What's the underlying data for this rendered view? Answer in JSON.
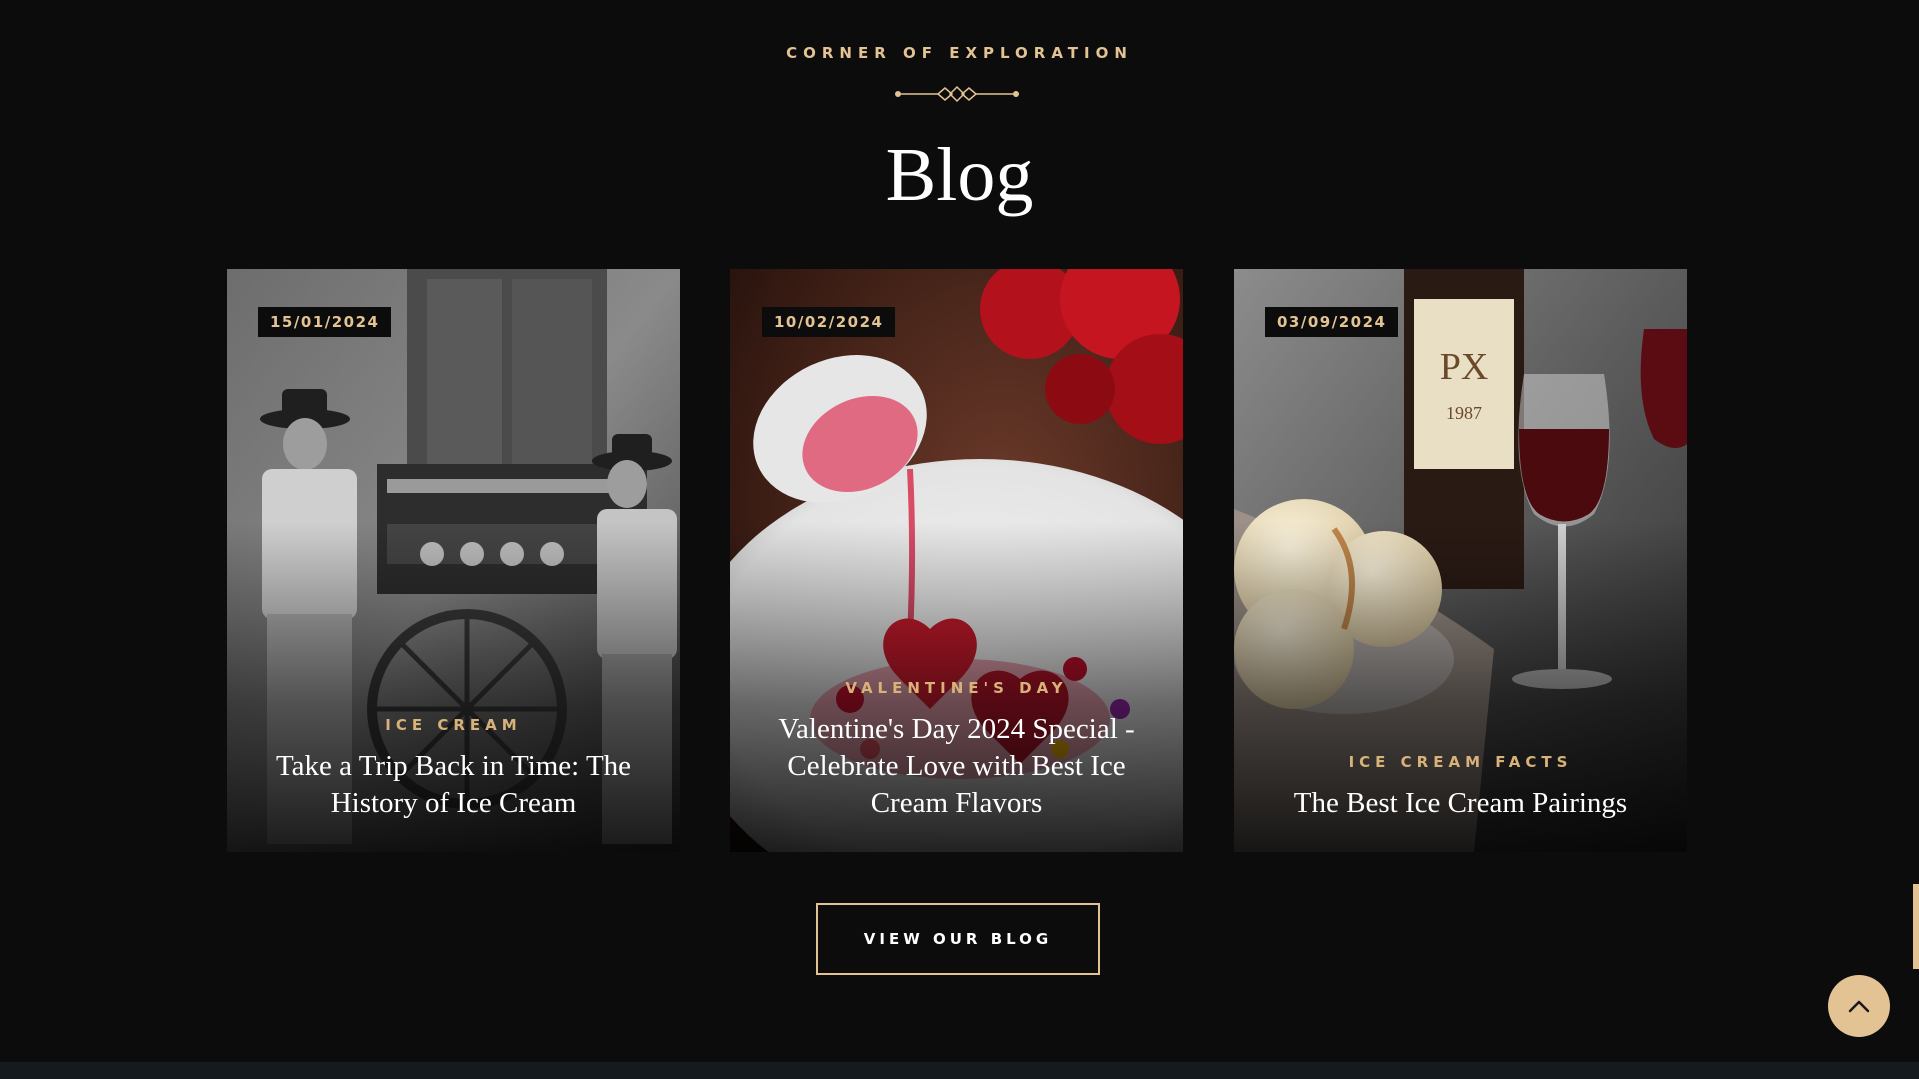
{
  "section": {
    "eyebrow": "CORNER OF EXPLORATION",
    "title": "Blog"
  },
  "posts": [
    {
      "date": "15/01/2024",
      "category": "ICE CREAM",
      "title": "Take a Trip Back in Time: The History of Ice Cream",
      "image": "vintage ice cream cart photo"
    },
    {
      "date": "10/02/2024",
      "category": "VALENTINE'S DAY",
      "title": "Valentine's Day 2024 Special - Celebrate Love with Best Ice Cream Flavors",
      "image": "heart dessert with red sauce"
    },
    {
      "date": "03/09/2024",
      "category": "ICE CREAM FACTS",
      "title": "The Best Ice Cream Pairings",
      "image": "ice cream with wine"
    }
  ],
  "cta": {
    "label": "VIEW OUR BLOG"
  },
  "icons": {
    "ornament": "diamond-divider-icon",
    "scroll_top": "chevron-up-icon"
  },
  "colors": {
    "background": "#0d0c0c",
    "accent": "#e3c393",
    "category": "#d9b27a",
    "footer": "#141a1e"
  }
}
